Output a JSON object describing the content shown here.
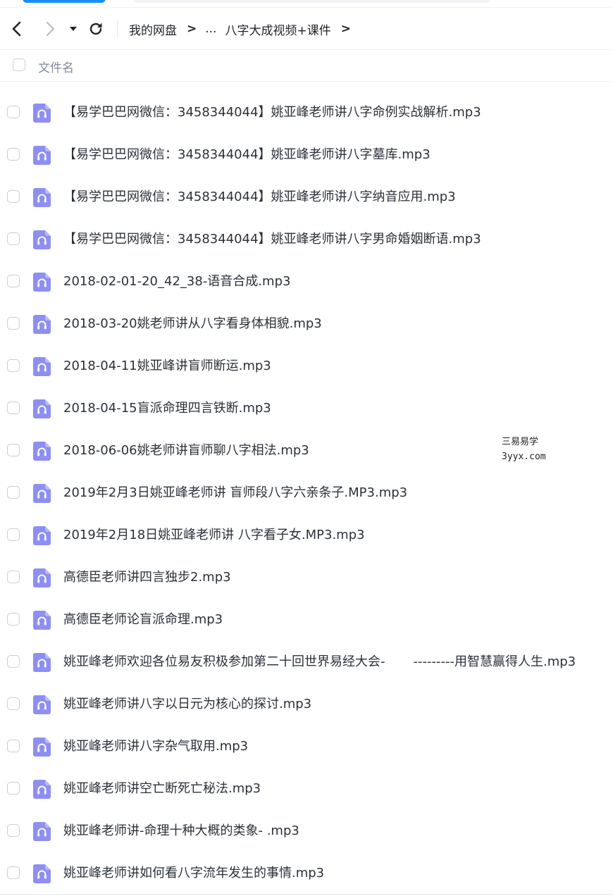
{
  "nav": {
    "back_icon": "chevron-left-icon",
    "forward_icon": "chevron-right-icon",
    "dropdown_icon": "caret-down-icon",
    "refresh_icon": "refresh-icon"
  },
  "breadcrumb": {
    "root": "我的网盘",
    "separator": ">",
    "ellipsis": "...",
    "current": "八字大成视频+课件"
  },
  "list_header": {
    "name_label": "文件名"
  },
  "files": [
    {
      "name": "【易学巴巴网微信：3458344044】姚亚峰老师讲八字命例实战解析.mp3"
    },
    {
      "name": "【易学巴巴网微信：3458344044】姚亚峰老师讲八字墓库.mp3"
    },
    {
      "name": "【易学巴巴网微信：3458344044】姚亚峰老师讲八字纳音应用.mp3"
    },
    {
      "name": "【易学巴巴网微信：3458344044】姚亚峰老师讲八字男命婚姻断语.mp3"
    },
    {
      "name": "2018-02-01-20_42_38-语音合成.mp3"
    },
    {
      "name": "2018-03-20姚老师讲从八字看身体相貌.mp3"
    },
    {
      "name": "2018-04-11姚亚峰讲盲师断运.mp3"
    },
    {
      "name": "2018-04-15盲派命理四言铁断.mp3"
    },
    {
      "name": "2018-06-06姚老师讲盲师聊八字相法.mp3"
    },
    {
      "name": "2019年2月3日姚亚峰老师讲 盲师段八字六亲条子.MP3.mp3"
    },
    {
      "name": "2019年2月18日姚亚峰老师讲 八字看子女.MP3.mp3"
    },
    {
      "name": "高德臣老师讲四言独步2.mp3"
    },
    {
      "name": "高德臣老师论盲派命理.mp3"
    },
    {
      "name": "姚亚峰老师欢迎各位易友积极参加第二十回世界易经大会-       ---------用智慧赢得人生.mp3"
    },
    {
      "name": "姚亚峰老师讲八字以日元为核心的探讨.mp3"
    },
    {
      "name": "姚亚峰老师讲八字杂气取用.mp3"
    },
    {
      "name": "姚亚峰老师讲空亡断死亡秘法.mp3"
    },
    {
      "name": "姚亚峰老师讲-命理十种大概的类象- .mp3"
    },
    {
      "name": "姚亚峰老师讲如何看八字流年发生的事情.mp3"
    }
  ],
  "file_icon": "audio-headphones-icon",
  "watermark": {
    "line1": "三易易学",
    "line2": "3yyx.com"
  },
  "colors": {
    "icon_bg": "#8d8ff2",
    "accent": "#1a8cff",
    "text": "#2b313a",
    "muted": "#818999"
  }
}
